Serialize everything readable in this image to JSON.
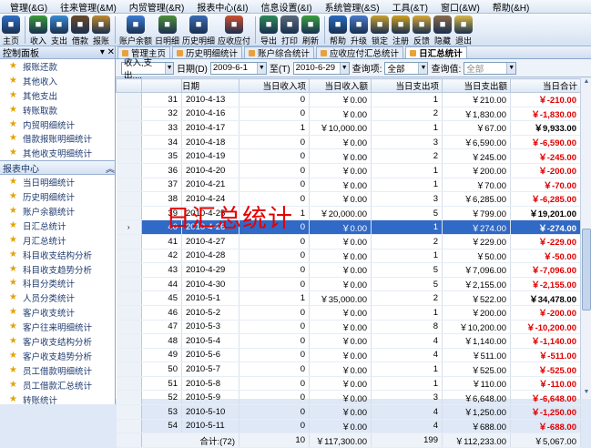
{
  "menu": [
    "管理(&G)",
    "往来管理(&M)",
    "内贸管理(&R)",
    "报表中心(&I)",
    "信息设置(&I)",
    "系统管理(&S)",
    "工具(&T)",
    "窗口(&W)",
    "帮助(&H)"
  ],
  "toolbar": [
    {
      "label": "主页",
      "icon": "home-icon",
      "color": "#2f6ec6"
    },
    {
      "label": "收入",
      "icon": "income-icon",
      "color": "#3a9a3a"
    },
    {
      "label": "支出",
      "icon": "expense-icon",
      "color": "#3a8ad0"
    },
    {
      "label": "借款",
      "icon": "borrow-icon",
      "color": "#6a4a2a"
    },
    {
      "label": "报账",
      "icon": "report-icon",
      "color": "#c08a30"
    },
    {
      "label": "账户余额",
      "icon": "balance-icon",
      "color": "#3b7cd4"
    },
    {
      "label": "日明细",
      "icon": "daily-icon",
      "color": "#4e8f3a"
    },
    {
      "label": "历史明细",
      "icon": "history-icon",
      "color": "#3b6ab4"
    },
    {
      "label": "应收应付",
      "icon": "receivable-icon",
      "color": "#d05030"
    },
    {
      "label": "导出",
      "icon": "export-icon",
      "color": "#2e8a5a"
    },
    {
      "label": "打印",
      "icon": "print-icon",
      "color": "#5a6a7a"
    },
    {
      "label": "刷新",
      "icon": "refresh-icon",
      "color": "#3aa040"
    },
    {
      "label": "帮助",
      "icon": "help-icon",
      "color": "#2a6ac0"
    },
    {
      "label": "升级",
      "icon": "upgrade-icon",
      "color": "#4a7ac8"
    },
    {
      "label": "锁定",
      "icon": "lock-icon",
      "color": "#c8a030"
    },
    {
      "label": "注册",
      "icon": "register-icon",
      "color": "#d0a020"
    },
    {
      "label": "反馈",
      "icon": "feedback-icon",
      "color": "#d8a838"
    },
    {
      "label": "隐藏",
      "icon": "hide-icon",
      "color": "#8a6a4a"
    },
    {
      "label": "退出",
      "icon": "exit-icon",
      "color": "#d8b848"
    }
  ],
  "left": {
    "title": "控制面板",
    "group1_items": [
      "报账还款",
      "其他收入",
      "其他支出",
      "转账取款",
      "内贸明细统计",
      "借款报账明细统计",
      "其他收支明细统计"
    ],
    "group2_title": "报表中心",
    "group2_items": [
      "当日明细统计",
      "历史明细统计",
      "账户余额统计",
      "日汇总统计",
      "月汇总统计",
      "科目收支结构分析",
      "科目收支趋势分析",
      "科目分类统计",
      "人员分类统计",
      "客户收支统计",
      "客户往来明细统计",
      "客户收支结构分析",
      "客户收支趋势分析",
      "员工借款明细统计",
      "员工借款汇总统计",
      "转账统计"
    ]
  },
  "tabs": [
    "管理主页",
    "历史明细统计",
    "账户综合统计",
    "应收应付汇总统计",
    "日汇总统计"
  ],
  "filter": {
    "type_value": "收入,支出,...",
    "date_label": "日期(D)",
    "date_from": "2009-6-1",
    "to_label": "至(T)",
    "date_to": "2010-6-29",
    "query_label": "查询项:",
    "query_value": "全部",
    "cond_label": "查询值:",
    "cond_value": "全部"
  },
  "columns": [
    "日期",
    "当日收入项",
    "当日收入额",
    "当日支出项",
    "当日支出额",
    "当日合计"
  ],
  "rows": [
    [
      "31",
      "2010-4-13",
      "0",
      "￥0.00",
      "1",
      "￥210.00",
      "￥-210.00"
    ],
    [
      "32",
      "2010-4-16",
      "0",
      "￥0.00",
      "2",
      "￥1,830.00",
      "￥-1,830.00"
    ],
    [
      "33",
      "2010-4-17",
      "1",
      "￥10,000.00",
      "1",
      "￥67.00",
      "￥9,933.00"
    ],
    [
      "34",
      "2010-4-18",
      "0",
      "￥0.00",
      "3",
      "￥6,590.00",
      "￥-6,590.00"
    ],
    [
      "35",
      "2010-4-19",
      "0",
      "￥0.00",
      "2",
      "￥245.00",
      "￥-245.00"
    ],
    [
      "36",
      "2010-4-20",
      "0",
      "￥0.00",
      "1",
      "￥200.00",
      "￥-200.00"
    ],
    [
      "37",
      "2010-4-21",
      "0",
      "￥0.00",
      "1",
      "￥70.00",
      "￥-70.00"
    ],
    [
      "38",
      "2010-4-24",
      "0",
      "￥0.00",
      "3",
      "￥6,285.00",
      "￥-6,285.00"
    ],
    [
      "39",
      "2010-4-25",
      "1",
      "￥20,000.00",
      "5",
      "￥799.00",
      "￥19,201.00"
    ],
    [
      "40",
      "2010-4-26",
      "0",
      "￥0.00",
      "1",
      "￥274.00",
      "￥-274.00"
    ],
    [
      "41",
      "2010-4-27",
      "0",
      "￥0.00",
      "2",
      "￥229.00",
      "￥-229.00"
    ],
    [
      "42",
      "2010-4-28",
      "0",
      "￥0.00",
      "1",
      "￥50.00",
      "￥-50.00"
    ],
    [
      "43",
      "2010-4-29",
      "0",
      "￥0.00",
      "5",
      "￥7,096.00",
      "￥-7,096.00"
    ],
    [
      "44",
      "2010-4-30",
      "0",
      "￥0.00",
      "5",
      "￥2,155.00",
      "￥-2,155.00"
    ],
    [
      "45",
      "2010-5-1",
      "1",
      "￥35,000.00",
      "2",
      "￥522.00",
      "￥34,478.00"
    ],
    [
      "46",
      "2010-5-2",
      "0",
      "￥0.00",
      "1",
      "￥200.00",
      "￥-200.00"
    ],
    [
      "47",
      "2010-5-3",
      "0",
      "￥0.00",
      "8",
      "￥10,200.00",
      "￥-10,200.00"
    ],
    [
      "48",
      "2010-5-4",
      "0",
      "￥0.00",
      "4",
      "￥1,140.00",
      "￥-1,140.00"
    ],
    [
      "49",
      "2010-5-6",
      "0",
      "￥0.00",
      "4",
      "￥511.00",
      "￥-511.00"
    ],
    [
      "50",
      "2010-5-7",
      "0",
      "￥0.00",
      "1",
      "￥525.00",
      "￥-525.00"
    ],
    [
      "51",
      "2010-5-8",
      "0",
      "￥0.00",
      "1",
      "￥110.00",
      "￥-110.00"
    ],
    [
      "52",
      "2010-5-9",
      "0",
      "￥0.00",
      "3",
      "￥6,648.00",
      "￥-6,648.00"
    ],
    [
      "53",
      "2010-5-10",
      "0",
      "￥0.00",
      "4",
      "￥1,250.00",
      "￥-1,250.00"
    ],
    [
      "54",
      "2010-5-11",
      "0",
      "￥0.00",
      "4",
      "￥688.00",
      "￥-688.00"
    ]
  ],
  "selected_row": "40",
  "footer": {
    "label": "合计:(72)",
    "income_items": "10",
    "income_total": "￥117,300.00",
    "expense_items": "199",
    "expense_total": "￥112,233.00",
    "net": "￥5,067.00"
  },
  "overlay_text": "日汇总统计"
}
